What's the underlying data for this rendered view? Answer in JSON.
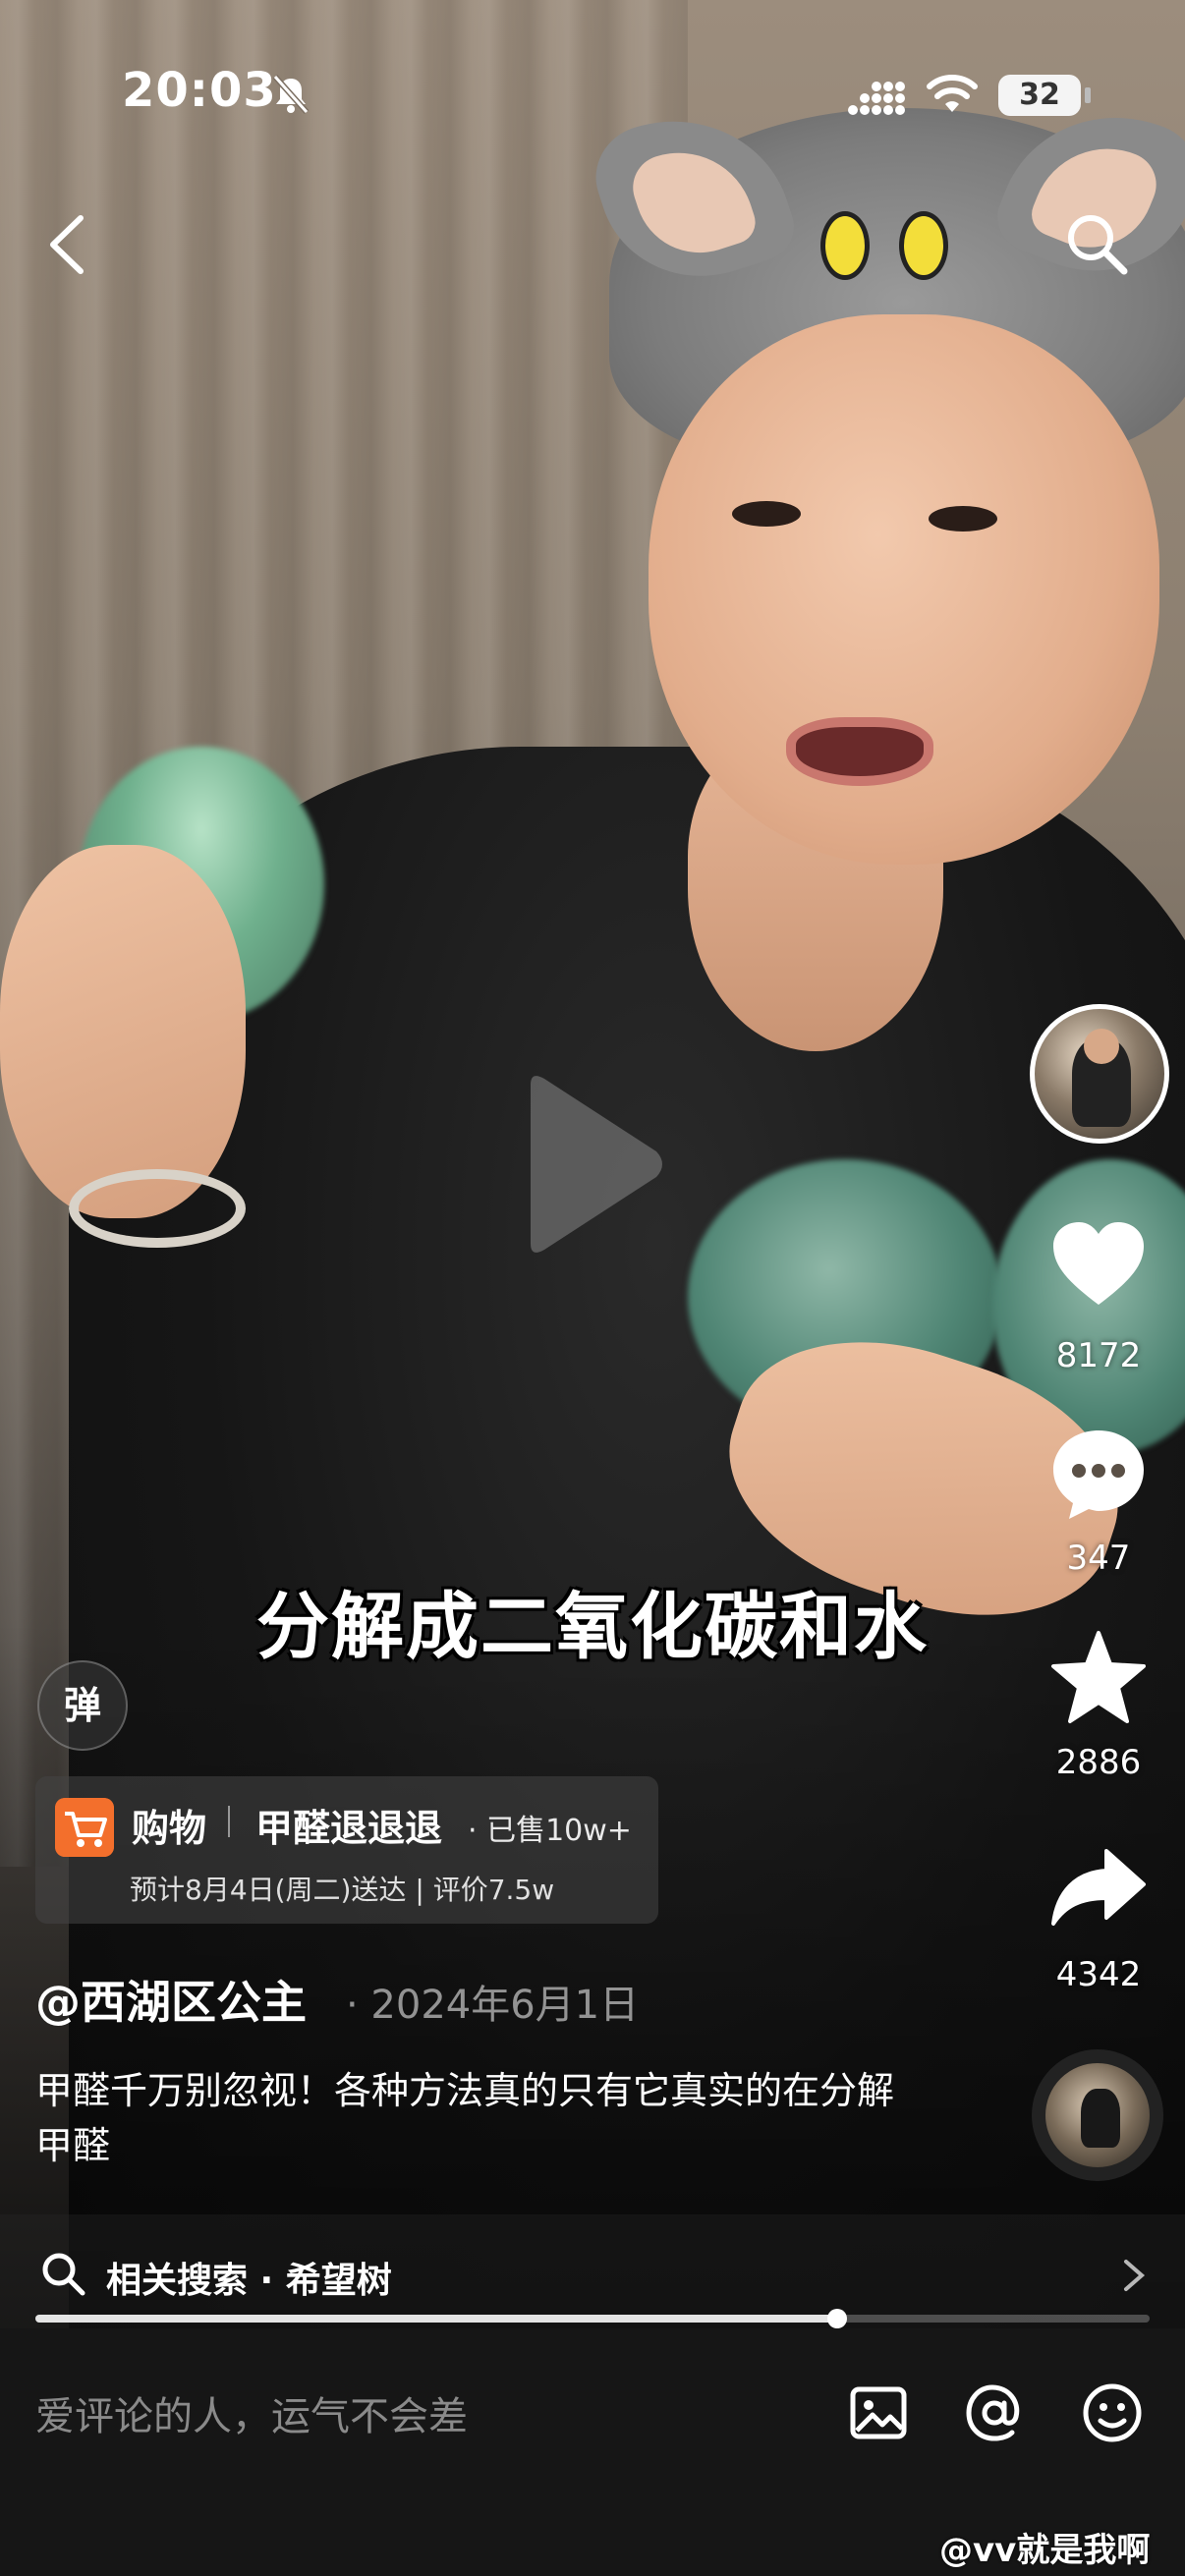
{
  "status_bar": {
    "time": "20:03",
    "battery": "32"
  },
  "video": {
    "subtitle": "分解成二氧化碳和水",
    "progress_fraction": 0.72
  },
  "actions": {
    "like_count": "8172",
    "comment_count": "347",
    "favorite_count": "2886",
    "share_count": "4342"
  },
  "danmaku": {
    "label": "弹"
  },
  "shop": {
    "label": "购物",
    "product": "甲醛退退退",
    "sold": "· 已售10w+",
    "delivery": "预计8月4日(周二)送达 | 评价7.5w"
  },
  "post": {
    "author": "@西湖区公主",
    "date": "· 2024年6月1日",
    "description": "甲醛千万别忽视！各种方法真的只有它真实的在分解甲醛"
  },
  "related": {
    "label": "相关搜索 · 希望树"
  },
  "comment": {
    "placeholder": "爱评论的人，运气不会差"
  },
  "watermark": "@vv就是我啊",
  "colors": {
    "shop_accent": "#f36f2c",
    "comment_bar_bg": "#161616"
  },
  "icons": [
    "back-icon",
    "search-icon",
    "play-icon",
    "heart-icon",
    "comment-icon",
    "star-icon",
    "share-icon",
    "image-icon",
    "at-icon",
    "emoji-icon",
    "cart-icon",
    "bell-off-icon",
    "wifi-icon",
    "signal-icon"
  ]
}
